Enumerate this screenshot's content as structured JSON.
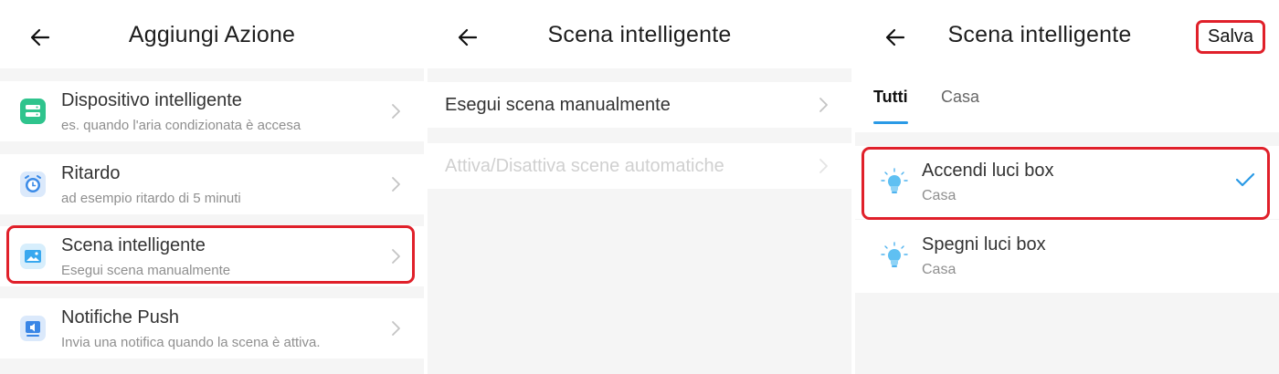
{
  "panel1": {
    "title": "Aggiungi Azione",
    "items": [
      {
        "title": "Dispositivo intelligente",
        "subtitle": "es. quando l'aria condizionata è accesa",
        "icon": "device-icon",
        "color": "#2fc48d"
      },
      {
        "title": "Ritardo",
        "subtitle": "ad esempio ritardo di 5 minuti",
        "icon": "alarm-clock-icon",
        "color": "#3b8be8"
      },
      {
        "title": "Scena intelligente",
        "subtitle": "Esegui scena manualmente",
        "icon": "image-icon",
        "color": "#38a8ef"
      },
      {
        "title": "Notifiche Push",
        "subtitle": "Invia una notifica quando la scena è attiva.",
        "icon": "notification-icon",
        "color": "#3a86e6"
      }
    ]
  },
  "panel2": {
    "title": "Scena intelligente",
    "items": [
      {
        "title": "Esegui scena manualmente",
        "enabled": true
      },
      {
        "title": "Attiva/Disattiva scene automatiche",
        "enabled": false
      }
    ]
  },
  "panel3": {
    "title": "Scena intelligente",
    "save_label": "Salva",
    "tabs": [
      {
        "label": "Tutti",
        "active": true
      },
      {
        "label": "Casa",
        "active": false
      }
    ],
    "scenes": [
      {
        "name": "Accendi luci box",
        "room": "Casa",
        "selected": true
      },
      {
        "name": "Spegni luci box",
        "room": "Casa",
        "selected": false
      }
    ]
  },
  "colors": {
    "highlight": "#e0202a",
    "accent": "#2a9ae6"
  }
}
